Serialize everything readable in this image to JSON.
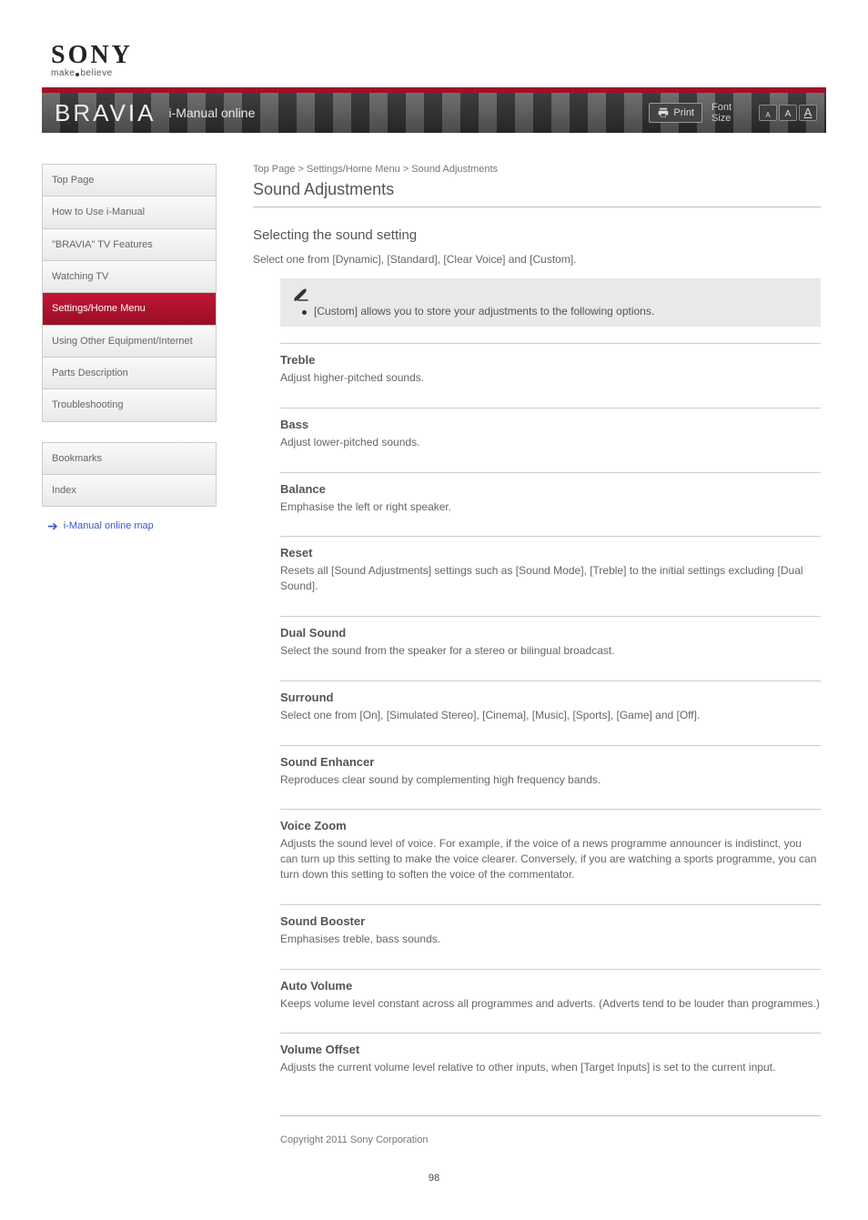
{
  "logo": {
    "brand": "SONY",
    "tagline_a": "make",
    "tagline_b": "believe"
  },
  "banner": {
    "brand": "BRAVIA",
    "title": "i-Manual online",
    "print": "Print",
    "fs": "A"
  },
  "nav": {
    "items": [
      {
        "label": "Top Page"
      },
      {
        "label": "How to Use i-Manual"
      },
      {
        "label": "\"BRAVIA\" TV Features"
      },
      {
        "label": "Watching TV"
      },
      {
        "label": "Settings/Home Menu"
      },
      {
        "label": "Using Other Equipment/Internet"
      },
      {
        "label": "Parts Description"
      },
      {
        "label": "Troubleshooting"
      },
      {
        "label": "Bookmarks"
      },
      {
        "label": "Index"
      }
    ],
    "link": "i-Manual online map",
    "active_index": 4
  },
  "crumb": "Top Page > Settings/Home Menu > Sound Adjustments",
  "h1": "Sound Adjustments",
  "h2": "Selecting the sound setting",
  "intro": "Select one from [Dynamic], [Standard], [Clear Voice] and [Custom].",
  "note_text": "[Custom] allows you to store your adjustments to the following options.",
  "items": [
    {
      "title": "Treble",
      "desc": "Adjust higher-pitched sounds."
    },
    {
      "title": "Bass",
      "desc": "Adjust lower-pitched sounds."
    },
    {
      "title": "Balance",
      "desc": "Emphasise the left or right speaker."
    },
    {
      "title": "Reset",
      "desc": "Resets all [Sound Adjustments] settings such as [Sound Mode], [Treble] to the initial settings excluding [Dual Sound]."
    },
    {
      "title": "Dual Sound",
      "desc": "Select the sound from the speaker for a stereo or bilingual broadcast."
    },
    {
      "title": "Surround",
      "desc": "Select one from [On], [Simulated Stereo], [Cinema], [Music], [Sports], [Game] and [Off]."
    },
    {
      "title": "Sound Enhancer",
      "desc": "Reproduces clear sound by complementing high frequency bands."
    },
    {
      "title": "Voice Zoom",
      "desc": "Adjusts the sound level of voice. For example, if the voice of a news programme announcer is indistinct, you can turn up this setting to make the voice clearer. Conversely, if you are watching a sports programme, you can turn down this setting to soften the voice of the commentator."
    },
    {
      "title": "Sound Booster",
      "desc": "Emphasises treble, bass sounds."
    },
    {
      "title": "Auto Volume",
      "desc": "Keeps volume level constant across all programmes and adverts. (Adverts tend to be louder than programmes.)"
    },
    {
      "title": "Volume Offset",
      "desc": "Adjusts the current volume level relative to other inputs, when [Target Inputs] is set to the current input."
    }
  ],
  "copyright": "Copyright 2011 Sony Corporation",
  "page_number": "98"
}
